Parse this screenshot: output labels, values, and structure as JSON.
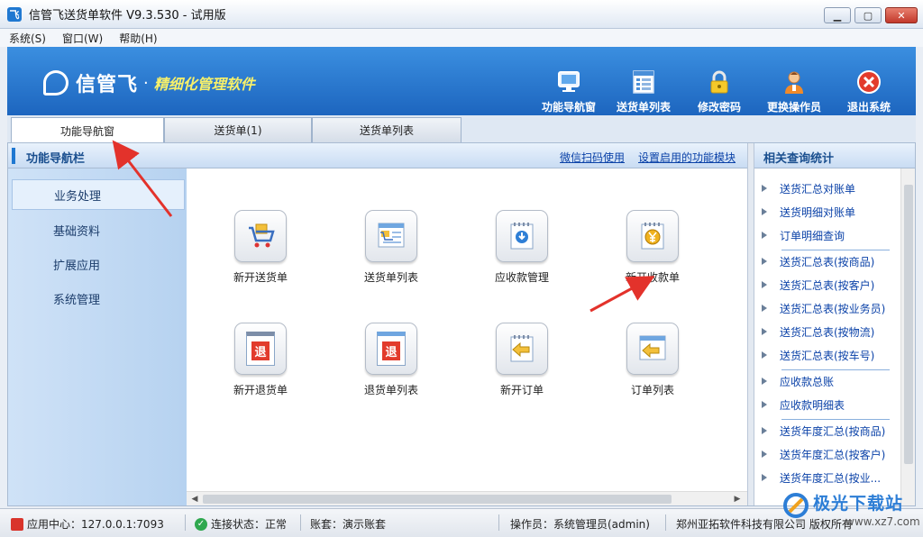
{
  "window": {
    "title": "信管飞送货单软件 V9.3.530 - 试用版",
    "app_icon_glyph": "飞"
  },
  "menu": [
    "系统(S)",
    "窗口(W)",
    "帮助(H)"
  ],
  "banner": {
    "brand_name": "信管飞",
    "dot": "·",
    "slogan": "精细化管理软件",
    "tools": [
      {
        "label": "功能导航窗",
        "icon": "monitor-icon"
      },
      {
        "label": "送货单列表",
        "icon": "list-icon"
      },
      {
        "label": "修改密码",
        "icon": "lock-icon"
      },
      {
        "label": "更换操作员",
        "icon": "user-icon"
      },
      {
        "label": "退出系统",
        "icon": "exit-icon"
      }
    ]
  },
  "tabs": [
    {
      "label": "功能导航窗",
      "active": true
    },
    {
      "label": "送货单(1)",
      "active": false
    },
    {
      "label": "送货单列表",
      "active": false
    }
  ],
  "nav": {
    "title": "功能导航栏",
    "links": [
      "微信扫码使用",
      "设置启用的功能模块"
    ],
    "sidebar": [
      {
        "label": "业务处理",
        "active": true
      },
      {
        "label": "基础资料",
        "active": false
      },
      {
        "label": "扩展应用",
        "active": false
      },
      {
        "label": "系统管理",
        "active": false
      }
    ],
    "functions": [
      {
        "label": "新开送货单",
        "icon": "cart-icon"
      },
      {
        "label": "送货单列表",
        "icon": "delivery-list-icon"
      },
      {
        "label": "应收款管理",
        "icon": "receivable-icon"
      },
      {
        "label": "新开收款单",
        "icon": "yen-receipt-icon"
      },
      {
        "label": "新开退货单",
        "icon": "return-note-icon",
        "stamp": "退"
      },
      {
        "label": "退货单列表",
        "icon": "return-list-icon",
        "stamp": "退"
      },
      {
        "label": "新开订单",
        "icon": "new-order-icon"
      },
      {
        "label": "订单列表",
        "icon": "order-list-icon"
      }
    ]
  },
  "related": {
    "title": "相关查询统计",
    "groups": [
      [
        "送货汇总对账单",
        "送货明细对账单",
        "订单明细查询"
      ],
      [
        "送货汇总表(按商品)",
        "送货汇总表(按客户)",
        "送货汇总表(按业务员)",
        "送货汇总表(按物流)",
        "送货汇总表(按车号)"
      ],
      [
        "应收款总账",
        "应收款明细表"
      ],
      [
        "送货年度汇总(按商品)",
        "送货年度汇总(按客户)",
        "送货年度汇总(按业..."
      ]
    ]
  },
  "status": {
    "center": "应用中心：127.0.0.1:7093",
    "connection": "连接状态：正常",
    "account": "账套：演示账套",
    "operator": "操作员：系统管理员(admin)",
    "company": "郑州亚拓软件科技有限公司 版权所有"
  },
  "watermark": {
    "text": "极光下载站",
    "sub": "www.xz7.com"
  },
  "colors": {
    "banner": "#1b63bd",
    "accent": "#1f78d1",
    "link": "#0b42a8",
    "slogan": "#f7f06a",
    "annotation_arrow": "#e3322b"
  }
}
